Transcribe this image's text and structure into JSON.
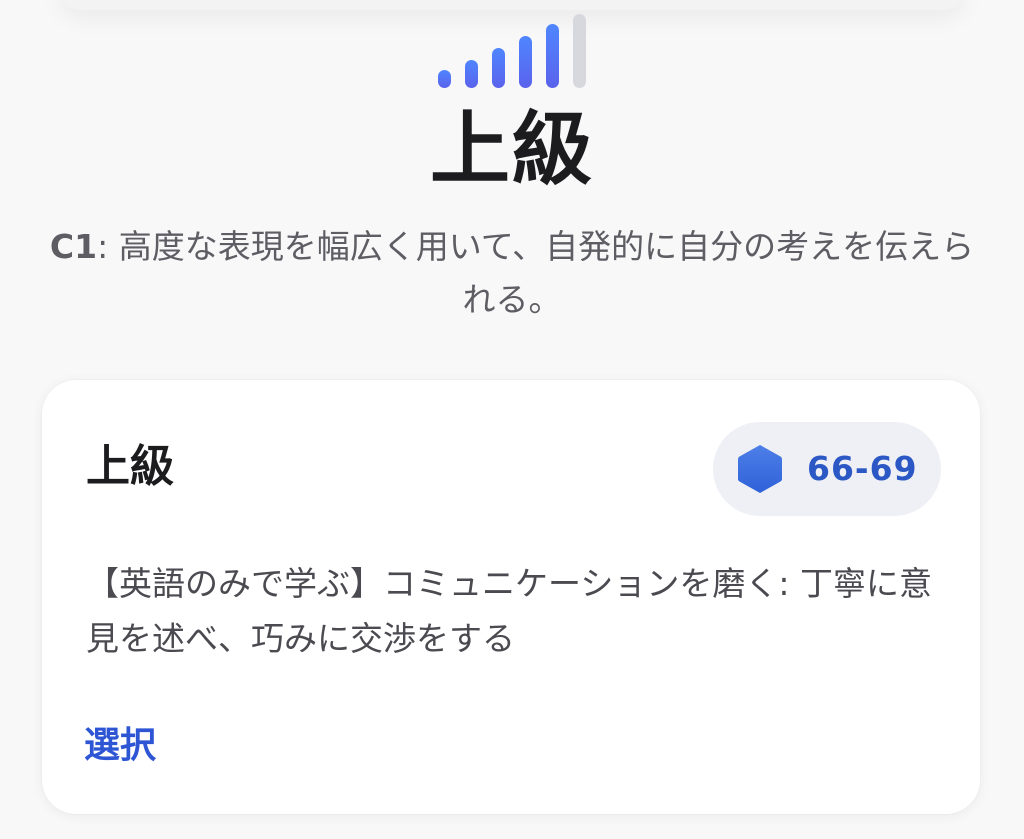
{
  "header": {
    "level_title": "上級",
    "level_code": "C1",
    "level_description": ": 高度な表現を幅広く用いて、自発的に自分の考えを伝えられる。",
    "level_icon_name": "signal-bars-icon",
    "level_bars_total": 6,
    "level_bars_filled": 5
  },
  "card": {
    "title": "上級",
    "score_range": "66-69",
    "score_icon_name": "hexagon-icon",
    "description": "【英語のみで学ぶ】コミュニケーションを磨く: 丁寧に意見を述べ、巧みに交渉をする",
    "select_label": "選択"
  },
  "colors": {
    "accent": "#2e56d4",
    "score_text": "#2b58c4",
    "bar_active": "#4f86ff",
    "bar_inactive": "#d6d8dd"
  }
}
